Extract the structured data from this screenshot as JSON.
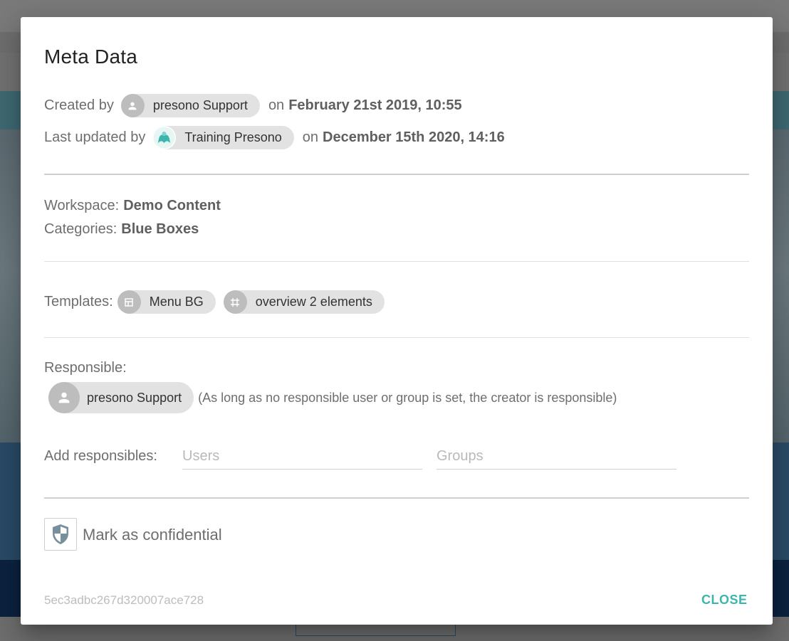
{
  "dialog": {
    "title": "Meta Data",
    "created": {
      "prefix": "Created by",
      "user": "presono Support",
      "on": "on",
      "date": "February 21st 2019, 10:55"
    },
    "updated": {
      "prefix": "Last updated by",
      "user": "Training Presono",
      "on": "on",
      "date": "December 15th 2020, 14:16"
    },
    "workspace": {
      "label": "Workspace:",
      "value": "Demo Content"
    },
    "categories": {
      "label": "Categories:",
      "value": "Blue Boxes"
    },
    "templates": {
      "label": "Templates:",
      "items": [
        "Menu BG",
        "overview 2 elements"
      ]
    },
    "responsible": {
      "label": "Responsible:",
      "user": "presono Support",
      "note": "(As long as no responsible user or group is set, the creator is responsible)"
    },
    "add_responsibles": {
      "label": "Add responsibles:",
      "users_placeholder": "Users",
      "groups_placeholder": "Groups"
    },
    "confidential": {
      "label": "Mark as confidential",
      "icon": "shield-icon"
    },
    "doc_id": "5ec3adbc267d320007ace728",
    "close_label": "CLOSE"
  },
  "colors": {
    "accent": "#3cb6ad",
    "chip_bg": "#e2e2e2",
    "text": "#6e6e6e"
  }
}
